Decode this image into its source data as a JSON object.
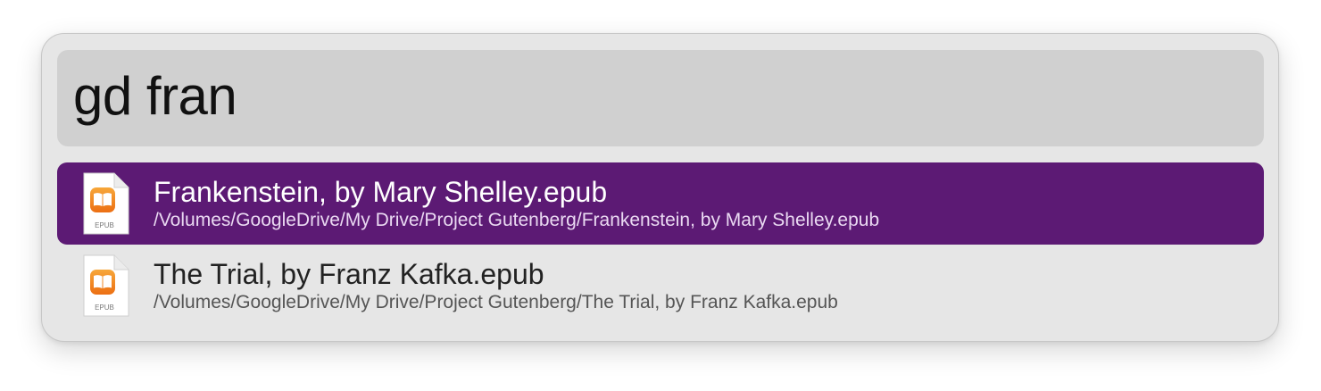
{
  "search": {
    "query": "gd fran"
  },
  "results": [
    {
      "title": "Frankenstein, by Mary Shelley.epub",
      "path": "/Volumes/GoogleDrive/My Drive/Project Gutenberg/Frankenstein, by Mary Shelley.epub",
      "icon": "epub-file-icon",
      "icon_label": "EPUB",
      "selected": true
    },
    {
      "title": "The Trial, by Franz Kafka.epub",
      "path": "/Volumes/GoogleDrive/My Drive/Project Gutenberg/The Trial, by Franz Kafka.epub",
      "icon": "epub-file-icon",
      "icon_label": "EPUB",
      "selected": false
    }
  ],
  "colors": {
    "selection": "#5c1a74",
    "panel": "#e6e6e6",
    "search_field": "#d0d0d0",
    "epub_orange": "#f08a1c"
  }
}
